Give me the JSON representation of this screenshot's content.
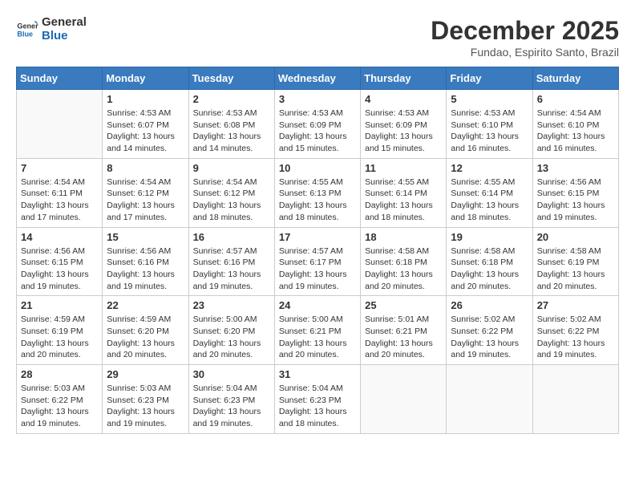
{
  "logo": {
    "text_general": "General",
    "text_blue": "Blue"
  },
  "title": "December 2025",
  "subtitle": "Fundao, Espirito Santo, Brazil",
  "days_of_week": [
    "Sunday",
    "Monday",
    "Tuesday",
    "Wednesday",
    "Thursday",
    "Friday",
    "Saturday"
  ],
  "weeks": [
    [
      {
        "day": "",
        "sunrise": "",
        "sunset": "",
        "daylight": ""
      },
      {
        "day": "1",
        "sunrise": "Sunrise: 4:53 AM",
        "sunset": "Sunset: 6:07 PM",
        "daylight": "Daylight: 13 hours and 14 minutes."
      },
      {
        "day": "2",
        "sunrise": "Sunrise: 4:53 AM",
        "sunset": "Sunset: 6:08 PM",
        "daylight": "Daylight: 13 hours and 14 minutes."
      },
      {
        "day": "3",
        "sunrise": "Sunrise: 4:53 AM",
        "sunset": "Sunset: 6:09 PM",
        "daylight": "Daylight: 13 hours and 15 minutes."
      },
      {
        "day": "4",
        "sunrise": "Sunrise: 4:53 AM",
        "sunset": "Sunset: 6:09 PM",
        "daylight": "Daylight: 13 hours and 15 minutes."
      },
      {
        "day": "5",
        "sunrise": "Sunrise: 4:53 AM",
        "sunset": "Sunset: 6:10 PM",
        "daylight": "Daylight: 13 hours and 16 minutes."
      },
      {
        "day": "6",
        "sunrise": "Sunrise: 4:54 AM",
        "sunset": "Sunset: 6:10 PM",
        "daylight": "Daylight: 13 hours and 16 minutes."
      }
    ],
    [
      {
        "day": "7",
        "sunrise": "Sunrise: 4:54 AM",
        "sunset": "Sunset: 6:11 PM",
        "daylight": "Daylight: 13 hours and 17 minutes."
      },
      {
        "day": "8",
        "sunrise": "Sunrise: 4:54 AM",
        "sunset": "Sunset: 6:12 PM",
        "daylight": "Daylight: 13 hours and 17 minutes."
      },
      {
        "day": "9",
        "sunrise": "Sunrise: 4:54 AM",
        "sunset": "Sunset: 6:12 PM",
        "daylight": "Daylight: 13 hours and 18 minutes."
      },
      {
        "day": "10",
        "sunrise": "Sunrise: 4:55 AM",
        "sunset": "Sunset: 6:13 PM",
        "daylight": "Daylight: 13 hours and 18 minutes."
      },
      {
        "day": "11",
        "sunrise": "Sunrise: 4:55 AM",
        "sunset": "Sunset: 6:14 PM",
        "daylight": "Daylight: 13 hours and 18 minutes."
      },
      {
        "day": "12",
        "sunrise": "Sunrise: 4:55 AM",
        "sunset": "Sunset: 6:14 PM",
        "daylight": "Daylight: 13 hours and 18 minutes."
      },
      {
        "day": "13",
        "sunrise": "Sunrise: 4:56 AM",
        "sunset": "Sunset: 6:15 PM",
        "daylight": "Daylight: 13 hours and 19 minutes."
      }
    ],
    [
      {
        "day": "14",
        "sunrise": "Sunrise: 4:56 AM",
        "sunset": "Sunset: 6:15 PM",
        "daylight": "Daylight: 13 hours and 19 minutes."
      },
      {
        "day": "15",
        "sunrise": "Sunrise: 4:56 AM",
        "sunset": "Sunset: 6:16 PM",
        "daylight": "Daylight: 13 hours and 19 minutes."
      },
      {
        "day": "16",
        "sunrise": "Sunrise: 4:57 AM",
        "sunset": "Sunset: 6:16 PM",
        "daylight": "Daylight: 13 hours and 19 minutes."
      },
      {
        "day": "17",
        "sunrise": "Sunrise: 4:57 AM",
        "sunset": "Sunset: 6:17 PM",
        "daylight": "Daylight: 13 hours and 19 minutes."
      },
      {
        "day": "18",
        "sunrise": "Sunrise: 4:58 AM",
        "sunset": "Sunset: 6:18 PM",
        "daylight": "Daylight: 13 hours and 20 minutes."
      },
      {
        "day": "19",
        "sunrise": "Sunrise: 4:58 AM",
        "sunset": "Sunset: 6:18 PM",
        "daylight": "Daylight: 13 hours and 20 minutes."
      },
      {
        "day": "20",
        "sunrise": "Sunrise: 4:58 AM",
        "sunset": "Sunset: 6:19 PM",
        "daylight": "Daylight: 13 hours and 20 minutes."
      }
    ],
    [
      {
        "day": "21",
        "sunrise": "Sunrise: 4:59 AM",
        "sunset": "Sunset: 6:19 PM",
        "daylight": "Daylight: 13 hours and 20 minutes."
      },
      {
        "day": "22",
        "sunrise": "Sunrise: 4:59 AM",
        "sunset": "Sunset: 6:20 PM",
        "daylight": "Daylight: 13 hours and 20 minutes."
      },
      {
        "day": "23",
        "sunrise": "Sunrise: 5:00 AM",
        "sunset": "Sunset: 6:20 PM",
        "daylight": "Daylight: 13 hours and 20 minutes."
      },
      {
        "day": "24",
        "sunrise": "Sunrise: 5:00 AM",
        "sunset": "Sunset: 6:21 PM",
        "daylight": "Daylight: 13 hours and 20 minutes."
      },
      {
        "day": "25",
        "sunrise": "Sunrise: 5:01 AM",
        "sunset": "Sunset: 6:21 PM",
        "daylight": "Daylight: 13 hours and 20 minutes."
      },
      {
        "day": "26",
        "sunrise": "Sunrise: 5:02 AM",
        "sunset": "Sunset: 6:22 PM",
        "daylight": "Daylight: 13 hours and 19 minutes."
      },
      {
        "day": "27",
        "sunrise": "Sunrise: 5:02 AM",
        "sunset": "Sunset: 6:22 PM",
        "daylight": "Daylight: 13 hours and 19 minutes."
      }
    ],
    [
      {
        "day": "28",
        "sunrise": "Sunrise: 5:03 AM",
        "sunset": "Sunset: 6:22 PM",
        "daylight": "Daylight: 13 hours and 19 minutes."
      },
      {
        "day": "29",
        "sunrise": "Sunrise: 5:03 AM",
        "sunset": "Sunset: 6:23 PM",
        "daylight": "Daylight: 13 hours and 19 minutes."
      },
      {
        "day": "30",
        "sunrise": "Sunrise: 5:04 AM",
        "sunset": "Sunset: 6:23 PM",
        "daylight": "Daylight: 13 hours and 19 minutes."
      },
      {
        "day": "31",
        "sunrise": "Sunrise: 5:04 AM",
        "sunset": "Sunset: 6:23 PM",
        "daylight": "Daylight: 13 hours and 18 minutes."
      },
      {
        "day": "",
        "sunrise": "",
        "sunset": "",
        "daylight": ""
      },
      {
        "day": "",
        "sunrise": "",
        "sunset": "",
        "daylight": ""
      },
      {
        "day": "",
        "sunrise": "",
        "sunset": "",
        "daylight": ""
      }
    ]
  ]
}
